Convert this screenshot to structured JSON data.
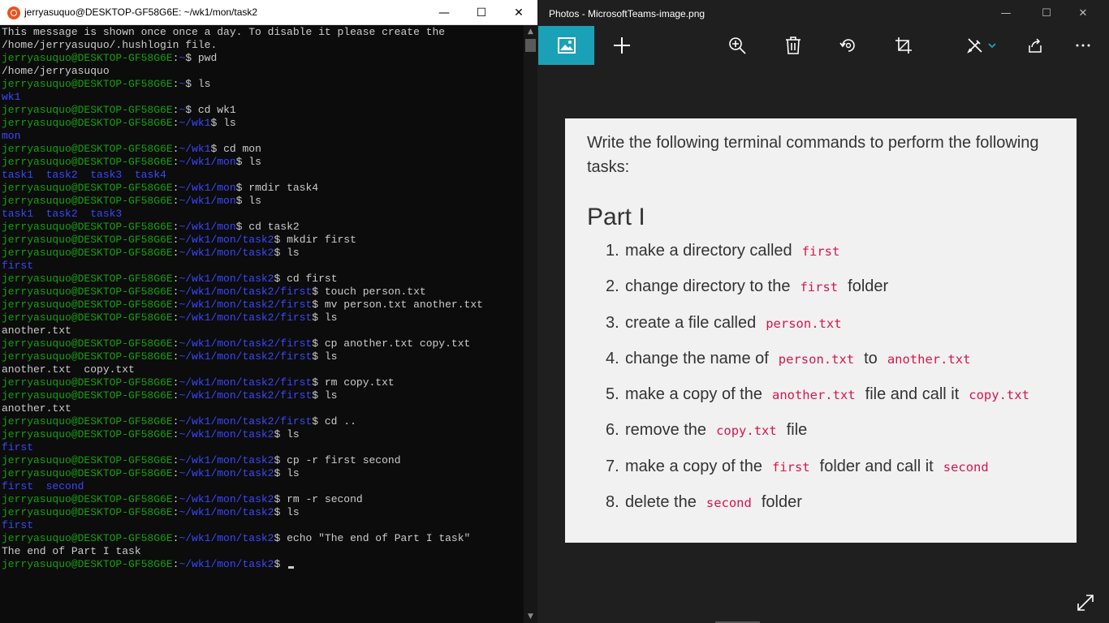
{
  "terminal": {
    "title": "jerryasuquo@DESKTOP-GF58G6E: ~/wk1/mon/task2",
    "controls": {
      "minimize": "—",
      "maximize": "☐",
      "close": "✕"
    },
    "lines": [
      [
        {
          "t": "This message is shown once once a day. To disable it please create the",
          "c": "o"
        }
      ],
      [
        {
          "t": "/home/jerryasuquo/.hushlogin file.",
          "c": "o"
        }
      ],
      [
        {
          "t": "jerryasuquo@DESKTOP-GF58G6E",
          "c": "u"
        },
        {
          "t": ":",
          "c": "o"
        },
        {
          "t": "~",
          "c": "p"
        },
        {
          "t": "$ pwd",
          "c": "o"
        }
      ],
      [
        {
          "t": "/home/jerryasuquo",
          "c": "o"
        }
      ],
      [
        {
          "t": "jerryasuquo@DESKTOP-GF58G6E",
          "c": "u"
        },
        {
          "t": ":",
          "c": "o"
        },
        {
          "t": "~",
          "c": "p"
        },
        {
          "t": "$ ls",
          "c": "o"
        }
      ],
      [
        {
          "t": "wk1",
          "c": "d"
        }
      ],
      [
        {
          "t": "jerryasuquo@DESKTOP-GF58G6E",
          "c": "u"
        },
        {
          "t": ":",
          "c": "o"
        },
        {
          "t": "~",
          "c": "p"
        },
        {
          "t": "$ cd wk1",
          "c": "o"
        }
      ],
      [
        {
          "t": "jerryasuquo@DESKTOP-GF58G6E",
          "c": "u"
        },
        {
          "t": ":",
          "c": "o"
        },
        {
          "t": "~/wk1",
          "c": "p"
        },
        {
          "t": "$ ls",
          "c": "o"
        }
      ],
      [
        {
          "t": "mon",
          "c": "d"
        }
      ],
      [
        {
          "t": "jerryasuquo@DESKTOP-GF58G6E",
          "c": "u"
        },
        {
          "t": ":",
          "c": "o"
        },
        {
          "t": "~/wk1",
          "c": "p"
        },
        {
          "t": "$ cd mon",
          "c": "o"
        }
      ],
      [
        {
          "t": "jerryasuquo@DESKTOP-GF58G6E",
          "c": "u"
        },
        {
          "t": ":",
          "c": "o"
        },
        {
          "t": "~/wk1/mon",
          "c": "p"
        },
        {
          "t": "$ ls",
          "c": "o"
        }
      ],
      [
        {
          "t": "task1  task2  task3  task4",
          "c": "d"
        }
      ],
      [
        {
          "t": "jerryasuquo@DESKTOP-GF58G6E",
          "c": "u"
        },
        {
          "t": ":",
          "c": "o"
        },
        {
          "t": "~/wk1/mon",
          "c": "p"
        },
        {
          "t": "$ rmdir task4",
          "c": "o"
        }
      ],
      [
        {
          "t": "jerryasuquo@DESKTOP-GF58G6E",
          "c": "u"
        },
        {
          "t": ":",
          "c": "o"
        },
        {
          "t": "~/wk1/mon",
          "c": "p"
        },
        {
          "t": "$ ls",
          "c": "o"
        }
      ],
      [
        {
          "t": "task1  task2  task3",
          "c": "d"
        }
      ],
      [
        {
          "t": "jerryasuquo@DESKTOP-GF58G6E",
          "c": "u"
        },
        {
          "t": ":",
          "c": "o"
        },
        {
          "t": "~/wk1/mon",
          "c": "p"
        },
        {
          "t": "$ cd task2",
          "c": "o"
        }
      ],
      [
        {
          "t": "jerryasuquo@DESKTOP-GF58G6E",
          "c": "u"
        },
        {
          "t": ":",
          "c": "o"
        },
        {
          "t": "~/wk1/mon/task2",
          "c": "p"
        },
        {
          "t": "$ mkdir first",
          "c": "o"
        }
      ],
      [
        {
          "t": "jerryasuquo@DESKTOP-GF58G6E",
          "c": "u"
        },
        {
          "t": ":",
          "c": "o"
        },
        {
          "t": "~/wk1/mon/task2",
          "c": "p"
        },
        {
          "t": "$ ls",
          "c": "o"
        }
      ],
      [
        {
          "t": "first",
          "c": "d"
        }
      ],
      [
        {
          "t": "jerryasuquo@DESKTOP-GF58G6E",
          "c": "u"
        },
        {
          "t": ":",
          "c": "o"
        },
        {
          "t": "~/wk1/mon/task2",
          "c": "p"
        },
        {
          "t": "$ cd first",
          "c": "o"
        }
      ],
      [
        {
          "t": "jerryasuquo@DESKTOP-GF58G6E",
          "c": "u"
        },
        {
          "t": ":",
          "c": "o"
        },
        {
          "t": "~/wk1/mon/task2/first",
          "c": "p"
        },
        {
          "t": "$ touch person.txt",
          "c": "o"
        }
      ],
      [
        {
          "t": "jerryasuquo@DESKTOP-GF58G6E",
          "c": "u"
        },
        {
          "t": ":",
          "c": "o"
        },
        {
          "t": "~/wk1/mon/task2/first",
          "c": "p"
        },
        {
          "t": "$ mv person.txt another.txt",
          "c": "o"
        }
      ],
      [
        {
          "t": "jerryasuquo@DESKTOP-GF58G6E",
          "c": "u"
        },
        {
          "t": ":",
          "c": "o"
        },
        {
          "t": "~/wk1/mon/task2/first",
          "c": "p"
        },
        {
          "t": "$ ls",
          "c": "o"
        }
      ],
      [
        {
          "t": "another.txt",
          "c": "o"
        }
      ],
      [
        {
          "t": "jerryasuquo@DESKTOP-GF58G6E",
          "c": "u"
        },
        {
          "t": ":",
          "c": "o"
        },
        {
          "t": "~/wk1/mon/task2/first",
          "c": "p"
        },
        {
          "t": "$ cp another.txt copy.txt",
          "c": "o"
        }
      ],
      [
        {
          "t": "jerryasuquo@DESKTOP-GF58G6E",
          "c": "u"
        },
        {
          "t": ":",
          "c": "o"
        },
        {
          "t": "~/wk1/mon/task2/first",
          "c": "p"
        },
        {
          "t": "$ ls",
          "c": "o"
        }
      ],
      [
        {
          "t": "another.txt  copy.txt",
          "c": "o"
        }
      ],
      [
        {
          "t": "jerryasuquo@DESKTOP-GF58G6E",
          "c": "u"
        },
        {
          "t": ":",
          "c": "o"
        },
        {
          "t": "~/wk1/mon/task2/first",
          "c": "p"
        },
        {
          "t": "$ rm copy.txt",
          "c": "o"
        }
      ],
      [
        {
          "t": "jerryasuquo@DESKTOP-GF58G6E",
          "c": "u"
        },
        {
          "t": ":",
          "c": "o"
        },
        {
          "t": "~/wk1/mon/task2/first",
          "c": "p"
        },
        {
          "t": "$ ls",
          "c": "o"
        }
      ],
      [
        {
          "t": "another.txt",
          "c": "o"
        }
      ],
      [
        {
          "t": "jerryasuquo@DESKTOP-GF58G6E",
          "c": "u"
        },
        {
          "t": ":",
          "c": "o"
        },
        {
          "t": "~/wk1/mon/task2/first",
          "c": "p"
        },
        {
          "t": "$ cd ..",
          "c": "o"
        }
      ],
      [
        {
          "t": "jerryasuquo@DESKTOP-GF58G6E",
          "c": "u"
        },
        {
          "t": ":",
          "c": "o"
        },
        {
          "t": "~/wk1/mon/task2",
          "c": "p"
        },
        {
          "t": "$ ls",
          "c": "o"
        }
      ],
      [
        {
          "t": "first",
          "c": "d"
        }
      ],
      [
        {
          "t": "jerryasuquo@DESKTOP-GF58G6E",
          "c": "u"
        },
        {
          "t": ":",
          "c": "o"
        },
        {
          "t": "~/wk1/mon/task2",
          "c": "p"
        },
        {
          "t": "$ cp -r first second",
          "c": "o"
        }
      ],
      [
        {
          "t": "jerryasuquo@DESKTOP-GF58G6E",
          "c": "u"
        },
        {
          "t": ":",
          "c": "o"
        },
        {
          "t": "~/wk1/mon/task2",
          "c": "p"
        },
        {
          "t": "$ ls",
          "c": "o"
        }
      ],
      [
        {
          "t": "first  second",
          "c": "d"
        }
      ],
      [
        {
          "t": "jerryasuquo@DESKTOP-GF58G6E",
          "c": "u"
        },
        {
          "t": ":",
          "c": "o"
        },
        {
          "t": "~/wk1/mon/task2",
          "c": "p"
        },
        {
          "t": "$ rm -r second",
          "c": "o"
        }
      ],
      [
        {
          "t": "jerryasuquo@DESKTOP-GF58G6E",
          "c": "u"
        },
        {
          "t": ":",
          "c": "o"
        },
        {
          "t": "~/wk1/mon/task2",
          "c": "p"
        },
        {
          "t": "$ ls",
          "c": "o"
        }
      ],
      [
        {
          "t": "first",
          "c": "d"
        }
      ],
      [
        {
          "t": "jerryasuquo@DESKTOP-GF58G6E",
          "c": "u"
        },
        {
          "t": ":",
          "c": "o"
        },
        {
          "t": "~/wk1/mon/task2",
          "c": "p"
        },
        {
          "t": "$ echo \"The end of Part I task\"",
          "c": "o"
        }
      ],
      [
        {
          "t": "The end of Part I task",
          "c": "o"
        }
      ],
      [
        {
          "t": "jerryasuquo@DESKTOP-GF58G6E",
          "c": "u"
        },
        {
          "t": ":",
          "c": "o"
        },
        {
          "t": "~/wk1/mon/task2",
          "c": "p"
        },
        {
          "t": "$ ",
          "c": "o"
        }
      ]
    ],
    "colors": {
      "user": "#13a10e",
      "path": "#3b47ff",
      "text": "#cccccc",
      "background": "#0c0c0c"
    }
  },
  "photos": {
    "title": "Photos - MicrosoftTeams-image.png",
    "controls": {
      "minimize": "—",
      "maximize": "☐",
      "close": "✕"
    },
    "toolbar": [
      "image-icon",
      "plus-icon",
      "zoom-in-icon",
      "delete-icon",
      "rotate-icon",
      "crop-icon",
      "edit-icon",
      "chevron-down-icon",
      "share-icon",
      "more-icon"
    ],
    "accent": "#1ba1b7",
    "image": {
      "intro": "Write the following terminal commands to perform the following tasks:",
      "heading": "Part I",
      "tasks": [
        {
          "num": "1.",
          "parts": [
            {
              "t": "make a directory called"
            },
            {
              "c": "first"
            }
          ]
        },
        {
          "num": "2.",
          "parts": [
            {
              "t": "change directory to the"
            },
            {
              "c": "first"
            },
            {
              "t": "folder"
            }
          ]
        },
        {
          "num": "3.",
          "parts": [
            {
              "t": "create a file called"
            },
            {
              "c": "person.txt"
            }
          ]
        },
        {
          "num": "4.",
          "parts": [
            {
              "t": "change the name of"
            },
            {
              "c": "person.txt"
            },
            {
              "t": "to"
            },
            {
              "c": "another.txt"
            }
          ]
        },
        {
          "num": "5.",
          "parts": [
            {
              "t": "make a copy of the"
            },
            {
              "c": "another.txt"
            },
            {
              "t": "file and call it"
            },
            {
              "c": "copy.txt"
            }
          ]
        },
        {
          "num": "6.",
          "parts": [
            {
              "t": "remove the"
            },
            {
              "c": "copy.txt"
            },
            {
              "t": "file"
            }
          ]
        },
        {
          "num": "7.",
          "parts": [
            {
              "t": "make a copy of the"
            },
            {
              "c": "first"
            },
            {
              "t": "folder and call it"
            },
            {
              "c": "second"
            }
          ]
        },
        {
          "num": "8.",
          "parts": [
            {
              "t": "delete the"
            },
            {
              "c": "second"
            },
            {
              "t": "folder"
            }
          ]
        }
      ]
    }
  }
}
